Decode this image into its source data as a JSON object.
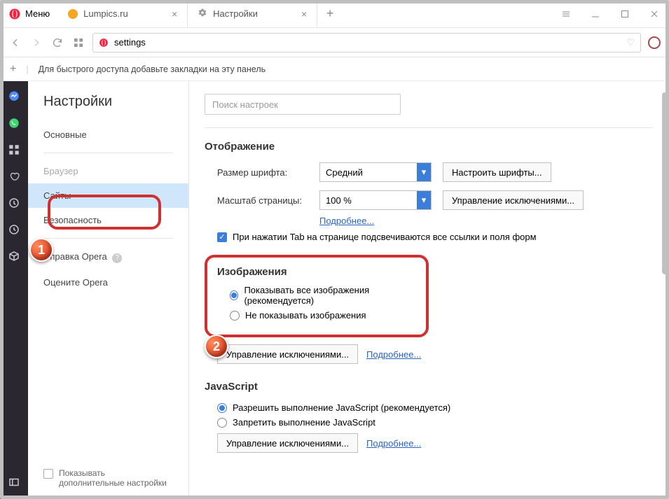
{
  "titlebar": {
    "menu_label": "Меню",
    "tabs": [
      {
        "label": "Lumpics.ru"
      },
      {
        "label": "Настройки"
      }
    ]
  },
  "address": {
    "value": "settings"
  },
  "bookmarks_hint": "Для быстрого доступа добавьте закладки на эту панель",
  "settings": {
    "title": "Настройки",
    "nav": {
      "basic": "Основные",
      "browser": "Браузер",
      "sites": "Сайты",
      "security": "Безопасность",
      "help": "Справка Opera",
      "rate": "Оцените Opera"
    },
    "advanced_checkbox": "Показывать дополнительные настройки",
    "search_placeholder": "Поиск настроек"
  },
  "display_section": {
    "title": "Отображение",
    "font_size_label": "Размер шрифта:",
    "font_size_value": "Средний",
    "font_btn": "Настроить шрифты...",
    "zoom_label": "Масштаб страницы:",
    "zoom_value": "100 %",
    "zoom_btn": "Управление исключениями...",
    "more_link": "Подробнее...",
    "tab_highlight": "При нажатии Tab на странице подсвечиваются все ссылки и поля форм"
  },
  "images_section": {
    "title": "Изображения",
    "opt_show": "Показывать все изображения (рекомендуется)",
    "opt_hide": "Не показывать изображения",
    "exceptions_btn": "Управление исключениями...",
    "more_link": "Подробнее..."
  },
  "js_section": {
    "title": "JavaScript",
    "opt_allow": "Разрешить выполнение JavaScript (рекомендуется)",
    "opt_block": "Запретить выполнение JavaScript",
    "exceptions_btn": "Управление исключениями...",
    "more_link": "Подробнее..."
  },
  "markers": {
    "one": "1",
    "two": "2"
  }
}
